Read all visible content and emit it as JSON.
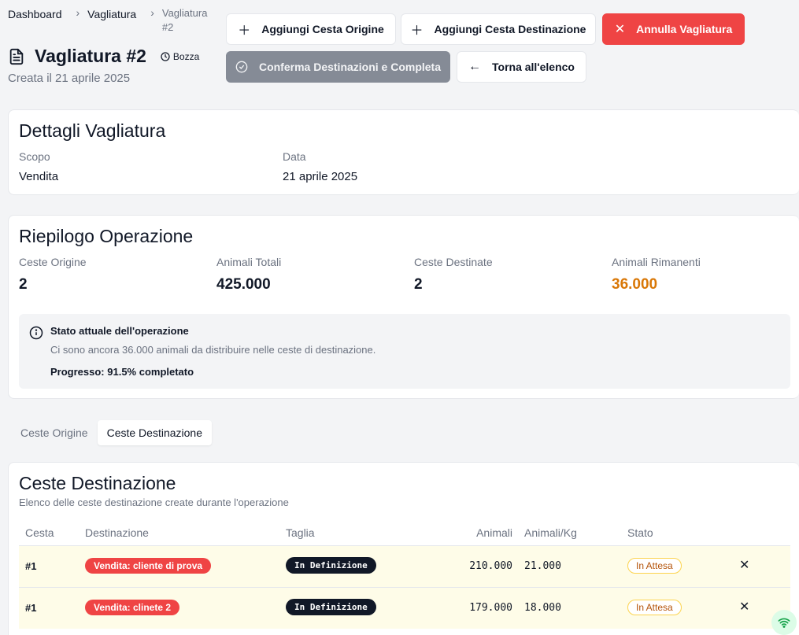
{
  "breadcrumb": {
    "home": "Dashboard",
    "section": "Vagliatura",
    "current": "Vagliatura #2"
  },
  "page": {
    "title": "Vagliatura #2",
    "status": "Bozza",
    "created": "Creata il 21 aprile 2025"
  },
  "actions": {
    "add_origin": "Aggiungi Cesta Origine",
    "add_dest": "Aggiungi Cesta Destinazione",
    "cancel": "Annulla Vagliatura",
    "confirm": "Conferma Destinazioni e Completa",
    "back": "Torna all'elenco"
  },
  "details": {
    "heading": "Dettagli Vagliatura",
    "scope_label": "Scopo",
    "scope_value": "Vendita",
    "date_label": "Data",
    "date_value": "21 aprile 2025"
  },
  "summary": {
    "heading": "Riepilogo Operazione",
    "stats": [
      {
        "label": "Ceste Origine",
        "value": "2"
      },
      {
        "label": "Animali Totali",
        "value": "425.000"
      },
      {
        "label": "Ceste Destinate",
        "value": "2"
      },
      {
        "label": "Animali Rimanenti",
        "value": "36.000"
      }
    ],
    "alert_title": "Stato attuale dell'operazione",
    "alert_text": "Ci sono ancora 36.000 animali da distribuire nelle ceste di destinazione.",
    "alert_progress": "Progresso: 91.5% completato",
    "remaining_color": "#d97706"
  },
  "tabs": [
    "Ceste Origine",
    "Ceste Destinazione"
  ],
  "dest": {
    "heading": "Ceste Destinazione",
    "subtitle": "Elenco delle ceste destinazione create durante l'operazione",
    "columns": [
      "Cesta",
      "Destinazione",
      "Taglia",
      "Animali",
      "Animali/Kg",
      "Stato"
    ],
    "rows": [
      {
        "cesta": "#1",
        "destinazione": "Vendita: cliente di prova",
        "taglia": "In Definizione",
        "animali": "210.000",
        "animali_kg": "21.000",
        "stato": "In Attesa"
      },
      {
        "cesta": "#1",
        "destinazione": "Vendita: clinete 2",
        "taglia": "In Definizione",
        "animali": "179.000",
        "animali_kg": "18.000",
        "stato": "In Attesa"
      }
    ]
  },
  "icons": {
    "document": "document-icon",
    "clock": "clock-icon",
    "plus": "plus-icon",
    "close": "close-icon",
    "check": "check-circle-icon",
    "arrow_left": "arrow-left-icon",
    "info": "info-icon",
    "wifi": "wifi-icon"
  }
}
